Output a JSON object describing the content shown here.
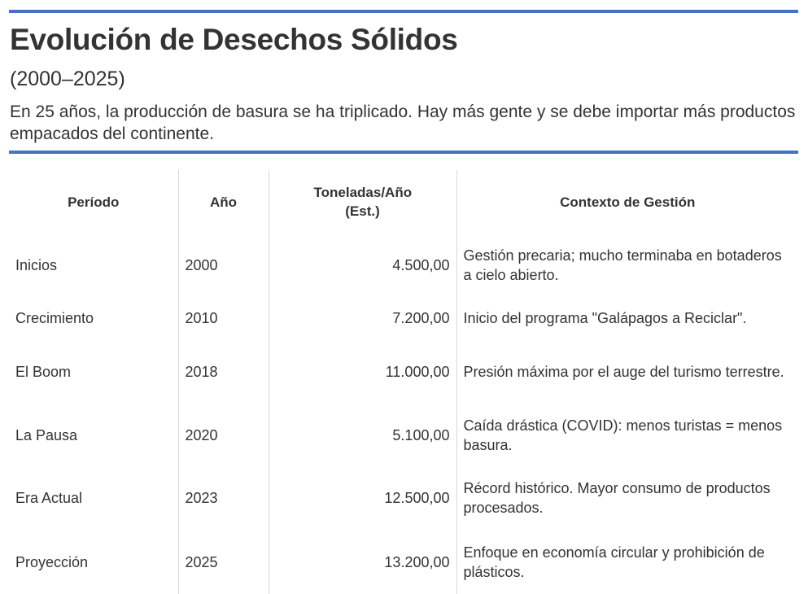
{
  "header": {
    "title": "Evolución de Desechos Sólidos",
    "subtitle": "(2000–2025)",
    "description": "En 25 años, la producción de basura se ha triplicado. Hay más gente y se debe importar más productos empacados del continente.",
    "accent_color": "#4472c4"
  },
  "table": {
    "columns": [
      "Período",
      "Año",
      "Toneladas/Año (Est.)",
      "Contexto de Gestión"
    ],
    "rows": [
      {
        "periodo": "Inicios",
        "anio": "2000",
        "toneladas": "4.500,00",
        "contexto": "Gestión precaria; mucho terminaba en botaderos a cielo abierto."
      },
      {
        "periodo": "Crecimiento",
        "anio": "2010",
        "toneladas": "7.200,00",
        "contexto": "Inicio del programa \"Galápagos a Reciclar\"."
      },
      {
        "periodo": "El Boom",
        "anio": "2018",
        "toneladas": "11.000,00",
        "contexto": "Presión máxima por el auge del turismo terrestre."
      },
      {
        "periodo": "La Pausa",
        "anio": "2020",
        "toneladas": "5.100,00",
        "contexto": "Caída drástica (COVID): menos turistas = menos basura."
      },
      {
        "periodo": "Era Actual",
        "anio": "2023",
        "toneladas": "12.500,00",
        "contexto": "Récord histórico. Mayor consumo de productos procesados."
      },
      {
        "periodo": "Proyección",
        "anio": "2025",
        "toneladas": "13.200,00",
        "contexto": "Enfoque en economía circular y prohibición de plásticos."
      }
    ]
  }
}
